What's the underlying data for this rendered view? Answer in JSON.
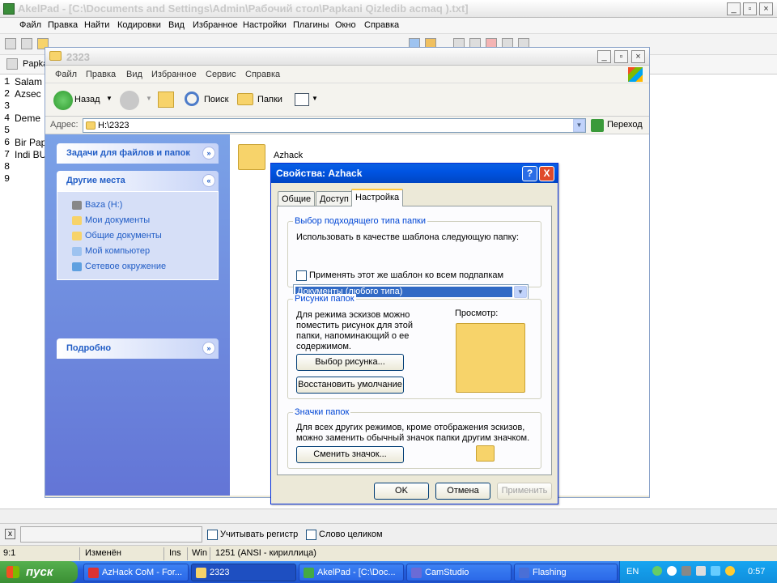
{
  "akelpad": {
    "title": "AkelPad - [C:\\Documents and Settings\\Admin\\Рабочий стол\\Papkani Qizledib acmaq ).txt]",
    "menu": [
      "Файл",
      "Правка",
      "Найти",
      "Кодировки",
      "Вид",
      "Избранное",
      "Настройки",
      "Плагины",
      "Окно",
      "Справка"
    ],
    "tab_label": "Papka",
    "lines": [
      {
        "num": "1",
        "text": "Salam"
      },
      {
        "num": "2",
        "text": "Azsec"
      },
      {
        "num": "3",
        "text": ""
      },
      {
        "num": "4",
        "text": "Deme"
      },
      {
        "num": "5",
        "text": ""
      },
      {
        "num": "6",
        "text": "Bir Pap"
      },
      {
        "num": "7",
        "text": "Indi BU"
      },
      {
        "num": "8",
        "text": ""
      },
      {
        "num": "9",
        "text": ""
      }
    ],
    "find": {
      "match_case": "Учитывать регистр",
      "whole_word": "Слово целиком",
      "close": "x"
    },
    "status": {
      "pos": "9:1",
      "modified": "Изменён",
      "ins": "Ins",
      "win": "Win",
      "codepage": "1251  (ANSI - кириллица)"
    }
  },
  "taskbar": {
    "start": "пуск",
    "tasks": [
      "AzHack CoM - For...",
      "2323",
      "AkelPad - [C:\\Doc...",
      "CamStudio",
      "Flashing"
    ],
    "lang": "EN",
    "clock": "0:57"
  },
  "explorer": {
    "title": "2323",
    "menu": [
      "Файл",
      "Правка",
      "Вид",
      "Избранное",
      "Сервис",
      "Справка"
    ],
    "back": "Назад",
    "search": "Поиск",
    "folders": "Папки",
    "address_label": "Адрес:",
    "address": "H:\\2323",
    "go": "Переход",
    "tasks_header": "Задачи для файлов и папок",
    "places_header": "Другие места",
    "places": [
      "Baza (H:)",
      "Мои документы",
      "Общие документы",
      "Мой компьютер",
      "Сетевое окружение"
    ],
    "details_header": "Подробно",
    "folder_name": "Azhack"
  },
  "dialog": {
    "title": "Свойства: Azhack",
    "help": "?",
    "close": "X",
    "tabs": [
      "Общие",
      "Доступ",
      "Настройка"
    ],
    "group1": "Выбор подходящего типа папки",
    "template_label": "Использовать в качестве шаблона следующую папку:",
    "template_value": "Документы (любого типа)",
    "apply_sub": "Применять этот же шаблон ко всем подпапкам",
    "group2": "Рисунки папок",
    "pic_desc": "Для режима эскизов можно поместить рисунок для этой папки, напоминающий о ее содержимом.",
    "preview": "Просмотр:",
    "choose_pic": "Выбор рисунка...",
    "restore": "Восстановить умолчание",
    "group3": "Значки папок",
    "icon_desc": "Для всех других режимов, кроме отображения эскизов, можно заменить обычный значок папки другим значком.",
    "change_icon": "Сменить значок...",
    "ok": "OK",
    "cancel": "Отмена",
    "apply": "Применить"
  }
}
